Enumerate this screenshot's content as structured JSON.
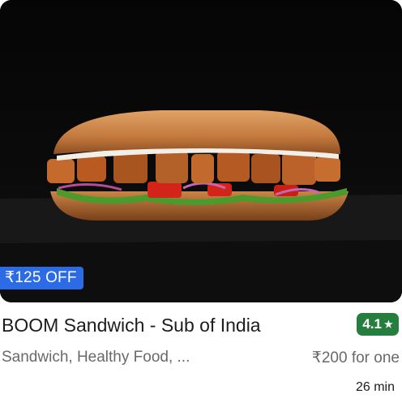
{
  "restaurant": {
    "name": "BOOM Sandwich - Sub of India",
    "rating": "4.1",
    "rating_icon": "star-icon",
    "cuisines": "Sandwich, Healthy Food, ...",
    "price_for_one": "₹200 for one",
    "delivery_time": "26 min",
    "offer": "₹125 OFF",
    "photo_icon": "sandwich-photo"
  },
  "colors": {
    "offer_bg": "#2b6ce6",
    "rating_bg": "#267e3e",
    "title_text": "#1c1c1c",
    "meta_text": "#696969"
  }
}
